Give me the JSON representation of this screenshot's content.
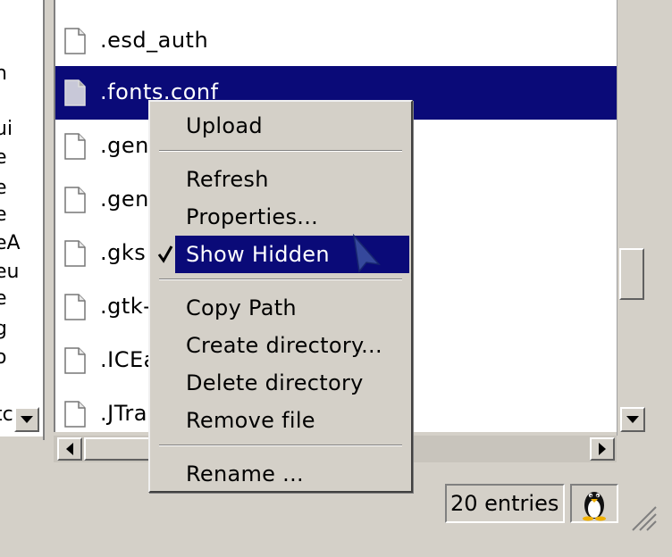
{
  "left_panel": {
    "fragments": [
      "n",
      "e",
      "ui",
      "e",
      "e",
      "eA",
      "eu",
      "e",
      "g",
      "o",
      "tc"
    ]
  },
  "file_list": {
    "rows": [
      {
        "name": ".esd_auth",
        "selected": false
      },
      {
        "name": ".fonts.conf",
        "selected": true
      },
      {
        "name": ".gen",
        "selected": false
      },
      {
        "name": ".gen",
        "selected": false
      },
      {
        "name": ".gks",
        "selected": false
      },
      {
        "name": ".gtk-",
        "selected": false
      },
      {
        "name": ".ICEa",
        "selected": false
      },
      {
        "name": ".JTrar",
        "selected": false
      }
    ]
  },
  "status": {
    "entries_label": "20 entries"
  },
  "context_menu": {
    "upload": "Upload",
    "refresh": "Refresh",
    "properties": "Properties...",
    "show_hidden": "Show Hidden",
    "copy_path": "Copy Path",
    "create_directory": "Create directory...",
    "delete_directory": "Delete directory",
    "remove_file": "Remove file",
    "rename": "Rename ..."
  },
  "colors": {
    "selection": "#0a0a78",
    "background": "#d4d0c8"
  }
}
